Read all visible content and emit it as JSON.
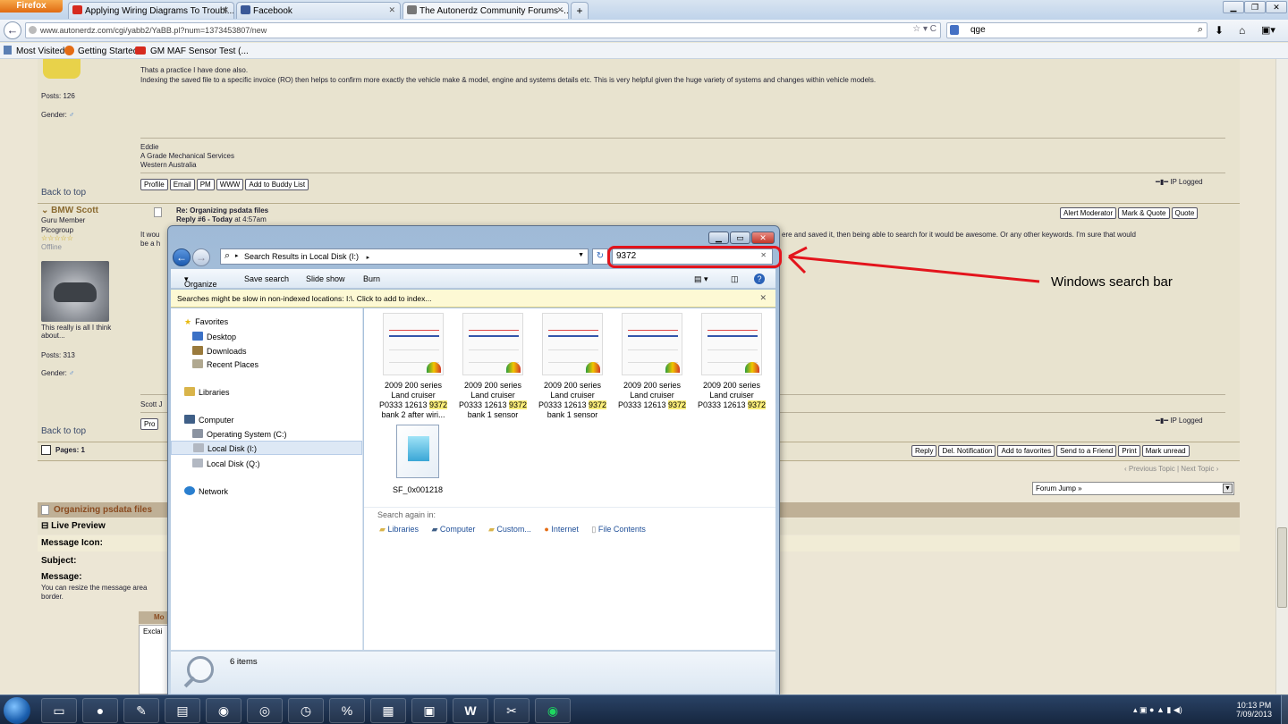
{
  "browser": {
    "app_button": "Firefox",
    "tabs": [
      {
        "label": "Applying Wiring Diagrams To Troubl...",
        "icon": "youtube-icon",
        "active": false
      },
      {
        "label": "Facebook",
        "icon": "facebook-icon",
        "active": false
      },
      {
        "label": "The Autonerdz Community Forums -...",
        "icon": "autonerdz-icon",
        "active": true
      }
    ],
    "new_tab": "+",
    "url": "www.autonerdz.com/cgi/yabb2/YaBB.pl?num=1373453807/new",
    "search_value": "qge",
    "bookmarks": [
      "Most Visited",
      "Getting Started",
      "GM MAF Sensor Test (..."
    ]
  },
  "forum": {
    "post1": {
      "text_line1": "Thats a practice I have done also.",
      "text_line2": "Indexing the saved file to a specific invoice (RO) then helps to confirm more exactly the vehicle make & model, engine and systems details etc. This is very helpful given the huge variety of systems and changes within vehicle models.",
      "posts": "Posts: 126",
      "gender": "Gender:",
      "sig1": "Eddie",
      "sig2": "A Grade Mechanical Services",
      "sig3": "Western Australia",
      "back_to_top": "Back to top",
      "ip_logged": "IP Logged",
      "buttons": [
        "Profile",
        "Email",
        "PM",
        "WWW",
        "Add to Buddy List"
      ]
    },
    "post2": {
      "user": "BMW Scott",
      "rank": "Guru Member",
      "group": "Picogroup",
      "status": "Offline",
      "stars": "☆☆☆☆☆",
      "title": "Re: Organizing psdata files",
      "reply_prefix": "Reply #6 - ",
      "reply_when": "Today",
      "reply_time": "at 4:57am",
      "text_left": "It wou",
      "text_left2": "be a h",
      "text_right": "ere and saved it, then being able to search for it would be awesome.  Or any other keywords.  I'm sure that would",
      "quote": "This really is all I think about...",
      "posts": "Posts: 313",
      "gender": "Gender:",
      "sig": "Scott J",
      "back_to_top": "Back to top",
      "ip_logged": "IP Logged",
      "buttons": [
        "Alert Moderator",
        "Mark & Quote",
        "Quote"
      ],
      "btm_buttons": [
        "Pro"
      ]
    },
    "pages": "Pages: 1",
    "page_buttons": [
      "Reply",
      "Del. Notification",
      "Add to favorites",
      "Send to a Friend",
      "Print",
      "Mark unread"
    ],
    "topic_nav": "‹ Previous Topic | Next Topic ›",
    "forum_jump": "Forum Jump »",
    "reply_box": {
      "header": "Organizing psdata files",
      "live_preview": "Live Preview",
      "message_icon": "Message Icon:",
      "subject": "Subject:",
      "message": "Message:",
      "resize_note": "You can resize the message area",
      "resize_note2": "border.",
      "mo": "Mo",
      "exclai": "Exclai"
    }
  },
  "explorer": {
    "breadcrumb": "Search Results in Local Disk (I:)",
    "search_value": "9372",
    "toolbar": [
      "Organize",
      "Save search",
      "Slide show",
      "Burn"
    ],
    "info_bar": "Searches might be slow in non-indexed locations: I:\\. Click to add to index...",
    "nav": {
      "favorites": "Favorites",
      "desktop": "Desktop",
      "downloads": "Downloads",
      "recent": "Recent Places",
      "libraries": "Libraries",
      "computer": "Computer",
      "os_c": "Operating System (C:)",
      "local_i": "Local Disk (I:)",
      "local_q": "Local Disk (Q:)",
      "network": "Network"
    },
    "files": [
      {
        "line1": "2009 200 series",
        "line2": "Land cruiser",
        "line3a": "P0333 12613 ",
        "line3b": "9372",
        "line4": "bank 2 after wiri..."
      },
      {
        "line1": "2009 200 series",
        "line2": "Land cruiser",
        "line3a": "P0333 12613 ",
        "line3b": "9372",
        "line4": "bank 1 sensor"
      },
      {
        "line1": "2009 200 series",
        "line2": "Land cruiser",
        "line3a": "P0333 12613 ",
        "line3b": "9372",
        "line4": "bank 1 sensor"
      },
      {
        "line1": "2009 200 series",
        "line2": "Land cruiser",
        "line3a": "P0333 12613 ",
        "line3b": "9372",
        "line4": ""
      },
      {
        "line1": "2009 200 series",
        "line2": "Land cruiser",
        "line3a": "P0333 12613 ",
        "line3b": "9372",
        "line4": ""
      }
    ],
    "doc_file": "SF_0x001218",
    "search_again": "Search again in:",
    "search_again_items": [
      "Libraries",
      "Computer",
      "Custom...",
      "Internet",
      "File Contents"
    ],
    "item_count": "6 items"
  },
  "annotation": {
    "label": "Windows search bar",
    "color": "#e3141c"
  },
  "taskbar": {
    "time": "10:13 PM",
    "date": "7/09/2013"
  }
}
